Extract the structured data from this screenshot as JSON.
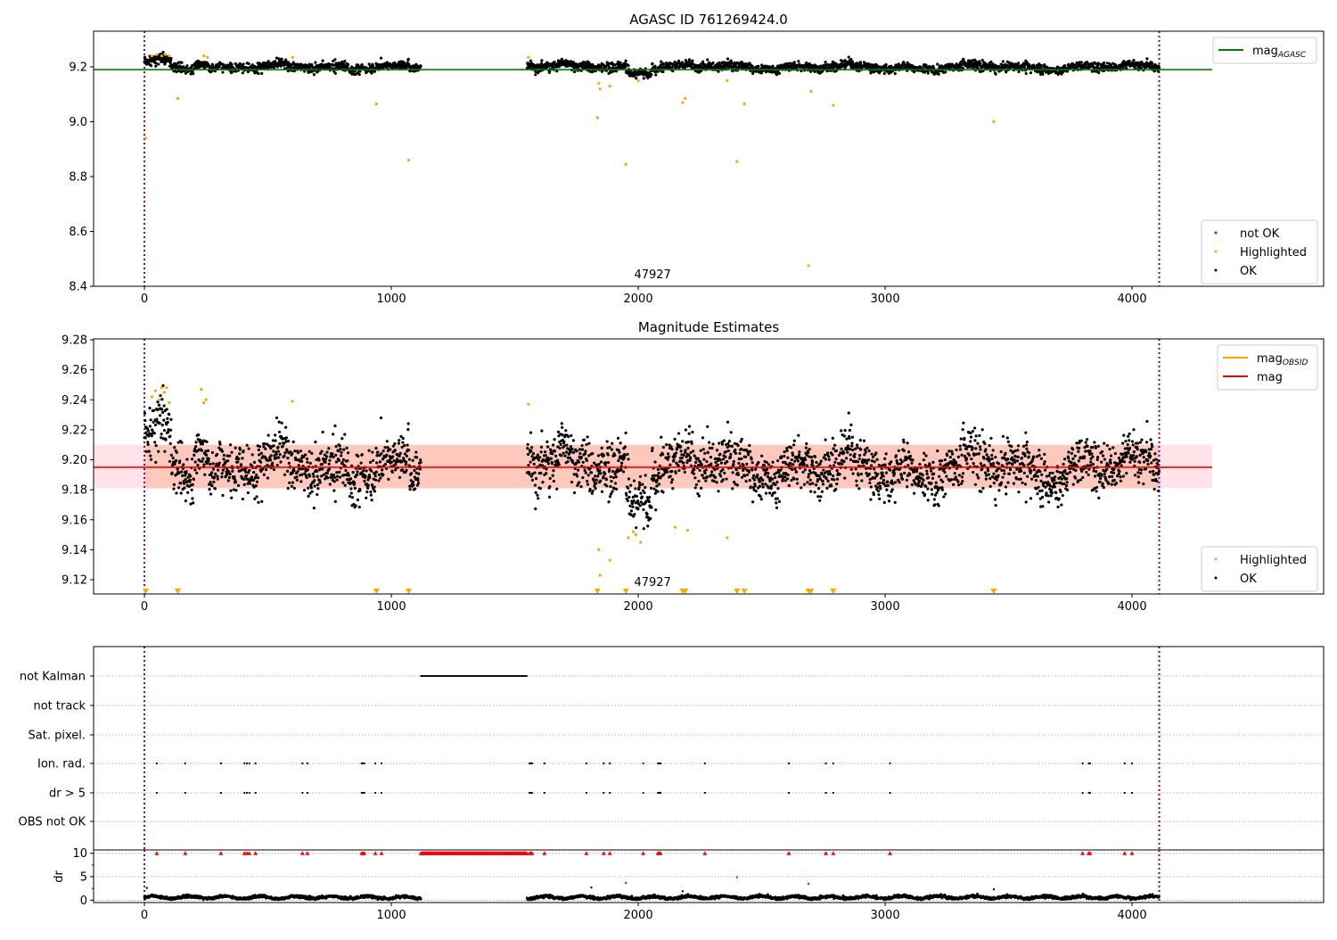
{
  "chart_data": [
    {
      "type": "scatter",
      "title": "AGASC ID 761269424.0",
      "xlim": [
        -206,
        4776
      ],
      "ylim": [
        8.4,
        9.33
      ],
      "xticks": [
        0,
        1000,
        2000,
        3000,
        4000
      ],
      "yticks": [
        8.4,
        8.6,
        8.8,
        9.0,
        9.2
      ],
      "ytick_labels": [
        "8.4",
        "8.6",
        "8.8",
        "9.0",
        "9.2"
      ],
      "obsid_label": "47927",
      "obsid_label_x": 2058,
      "mag_agasc": 9.19,
      "mag_agasc_xrange": [
        -206,
        4325
      ],
      "obs_bounds": [
        0,
        4110
      ],
      "legend_upper": {
        "location": "top-right",
        "entries": [
          {
            "label": "mag",
            "sub": "AGASC",
            "color": "#008000"
          }
        ]
      },
      "legend_lower": {
        "location": "bottom-right",
        "entries": [
          {
            "label": "not OK",
            "color": "#ff0000"
          },
          {
            "label": "Highlighted",
            "color": "#ffa500"
          },
          {
            "label": "OK",
            "color": "#000000"
          }
        ]
      },
      "ok_segments": [
        [
          0,
          1120
        ],
        [
          1550,
          4110
        ]
      ],
      "highlighted": [
        [
          5,
          8.94
        ],
        [
          135,
          9.085
        ],
        [
          940,
          9.065
        ],
        [
          1070,
          8.86
        ],
        [
          1835,
          9.015
        ],
        [
          1840,
          9.14
        ],
        [
          1845,
          9.12
        ],
        [
          1885,
          9.13
        ],
        [
          1950,
          8.845
        ],
        [
          2000,
          9.15
        ],
        [
          2180,
          9.07
        ],
        [
          2190,
          9.085
        ],
        [
          2360,
          9.15
        ],
        [
          2400,
          8.855
        ],
        [
          2430,
          9.065
        ],
        [
          2690,
          8.475
        ],
        [
          2700,
          9.11
        ],
        [
          2790,
          9.06
        ],
        [
          3440,
          9.0
        ],
        [
          30,
          9.24
        ],
        [
          50,
          9.245
        ],
        [
          70,
          9.24
        ],
        [
          85,
          9.245
        ],
        [
          100,
          9.24
        ],
        [
          240,
          9.24
        ],
        [
          255,
          9.235
        ],
        [
          600,
          9.235
        ],
        [
          1555,
          9.235
        ]
      ]
    },
    {
      "type": "scatter",
      "title": "Magnitude Estimates",
      "xlim": [
        -206,
        4776
      ],
      "ylim": [
        9.1105,
        9.2806
      ],
      "xticks": [
        0,
        1000,
        2000,
        3000,
        4000
      ],
      "yticks": [
        9.12,
        9.14,
        9.16,
        9.18,
        9.2,
        9.22,
        9.24,
        9.26,
        9.28
      ],
      "ytick_labels": [
        "9.12",
        "9.14",
        "9.16",
        "9.18",
        "9.20",
        "9.22",
        "9.24",
        "9.26",
        "9.28"
      ],
      "obsid_label": "47927",
      "mag": 9.195,
      "mag_band": [
        9.181,
        9.21
      ],
      "mag_obsid_band": [
        9.181,
        9.21
      ],
      "legend_upper": {
        "location": "top-right",
        "entries": [
          {
            "label": "mag",
            "sub": "OBSID",
            "color": "#ffa500"
          },
          {
            "label": "mag",
            "sub": "",
            "color": "#ff0000"
          }
        ]
      },
      "legend_lower": {
        "location": "bottom-right",
        "entries": [
          {
            "label": "Highlighted",
            "color": "#ffa500"
          },
          {
            "label": "OK",
            "color": "#000000"
          }
        ]
      },
      "highlighted": [
        [
          30,
          9.242
        ],
        [
          45,
          9.246
        ],
        [
          60,
          9.24
        ],
        [
          70,
          9.248
        ],
        [
          80,
          9.245
        ],
        [
          90,
          9.248
        ],
        [
          100,
          9.238
        ],
        [
          230,
          9.247
        ],
        [
          240,
          9.238
        ],
        [
          250,
          9.24
        ],
        [
          600,
          9.239
        ],
        [
          1555,
          9.237
        ],
        [
          1840,
          9.14
        ],
        [
          1845,
          9.123
        ],
        [
          1885,
          9.133
        ],
        [
          1960,
          9.148
        ],
        [
          1980,
          9.152
        ],
        [
          1990,
          9.15
        ],
        [
          2010,
          9.145
        ],
        [
          2150,
          9.155
        ],
        [
          2200,
          9.153
        ],
        [
          2360,
          9.148
        ]
      ],
      "off_scale_low": [
        5,
        135,
        940,
        1070,
        1835,
        1950,
        2180,
        2190,
        2400,
        2430,
        2690,
        2700,
        2790,
        3440
      ]
    },
    {
      "type": "scatter",
      "title": "",
      "categories": [
        "not Kalman",
        "not track",
        "Sat. pixel.",
        "Ion. rad.",
        "dr > 5",
        "OBS not OK"
      ],
      "not_kalman_range": [
        1120,
        1550
      ],
      "ion_rad_times": [
        50,
        165,
        310,
        405,
        415,
        425,
        450,
        640,
        660,
        880,
        885,
        890,
        935,
        960,
        1560,
        1565,
        1570,
        1620,
        1790,
        1860,
        1885,
        2020,
        2080,
        2085,
        2090,
        2270,
        2610,
        2760,
        2790,
        3020,
        3800,
        3825,
        3830,
        3970,
        4000
      ],
      "dr_gt5_times": [
        50,
        165,
        310,
        405,
        415,
        425,
        450,
        640,
        660,
        880,
        885,
        890,
        935,
        960,
        1560,
        1565,
        1570,
        1620,
        1790,
        1860,
        1885,
        2020,
        2080,
        2085,
        2090,
        2270,
        2610,
        2760,
        2790,
        3020,
        3800,
        3825,
        3830,
        3970,
        4000
      ]
    },
    {
      "type": "scatter",
      "ylabel": "dr",
      "ylim": [
        -0.5,
        10.7
      ],
      "yticks": [
        0,
        5,
        10
      ],
      "ytick_labels": [
        "0",
        "5",
        "10"
      ],
      "xticks": [
        0,
        1000,
        2000,
        3000,
        4000
      ],
      "xtick_labels": [
        "0",
        "1000",
        "2000",
        "3000",
        "4000"
      ],
      "typical_dr": 0.6,
      "clipped_at": 10,
      "outliers": [
        [
          10,
          2.6
        ],
        [
          1810,
          2.7
        ],
        [
          1950,
          3.7
        ],
        [
          2180,
          1.9
        ],
        [
          2400,
          4.9
        ],
        [
          2690,
          3.5
        ],
        [
          3440,
          2.3
        ]
      ]
    }
  ]
}
